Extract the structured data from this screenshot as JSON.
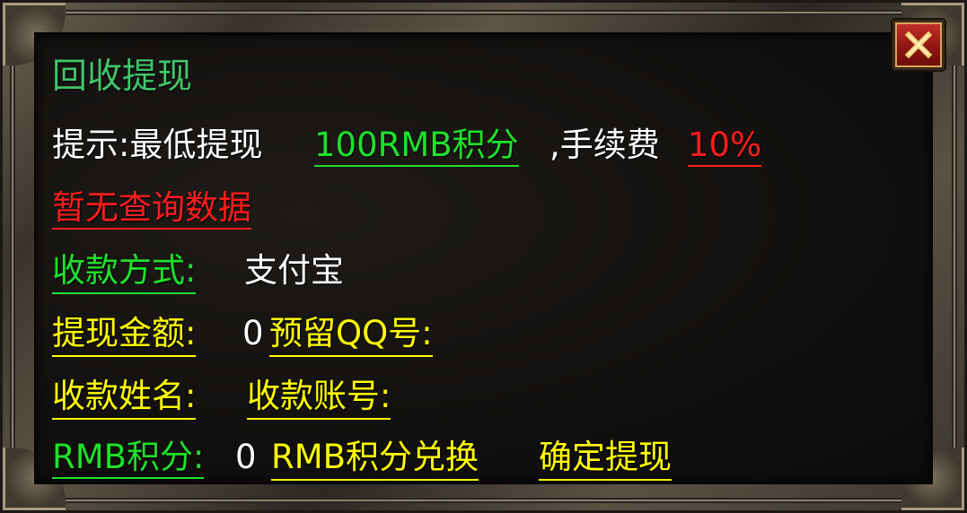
{
  "dialog": {
    "title": "回收提现",
    "tip": {
      "prefix": "提示:最低提现",
      "min_amount": "100RMB积分",
      "fee_label": ",手续费",
      "fee_value": "10%"
    },
    "no_data": "暂无查询数据",
    "payment_method": {
      "label": "收款方式:",
      "value": "支付宝"
    },
    "withdraw_amount": {
      "label": "提现金额:",
      "value": "0"
    },
    "reserved_qq": {
      "label": "预留QQ号:"
    },
    "payee_name": {
      "label": "收款姓名:"
    },
    "payee_account": {
      "label": "收款账号:"
    },
    "rmb_points": {
      "label": "RMB积分:",
      "value": "0"
    },
    "exchange_label": "RMB积分兑换",
    "confirm_label": "确定提现",
    "close_icon": "close-x-icon",
    "colors": {
      "title": "#42c46b",
      "green": "#1fe12c",
      "red": "#ff1c1c",
      "yellow": "#ffff00",
      "white": "#ffffff"
    }
  }
}
